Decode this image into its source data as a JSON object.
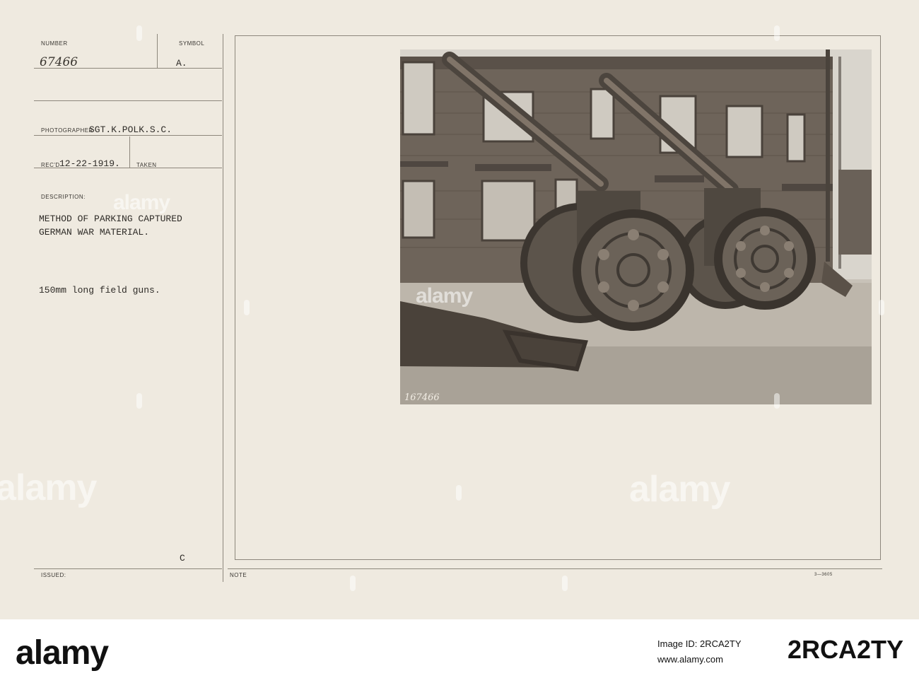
{
  "record": {
    "number_label": "NUMBER",
    "number": "67466",
    "symbol_label": "SYMBOL",
    "symbol": "A.",
    "photographer_label": "PHOTOGRAPHER",
    "photographer": "SGT.K.POLK.S.C.",
    "recd_label": "REC'D",
    "recd_date": "12-22-1919.",
    "taken_label": "TAKEN",
    "description_label": "DESCRIPTION:",
    "description_line1": "METHOD OF PARKING CAPTURED",
    "description_line2": "GERMAN WAR MATERIAL.",
    "subject": "150mm long field guns.",
    "issued_label": "ISSUED:",
    "issued_letter": "C",
    "note_label": "NOTE",
    "form_code": "3—3605"
  },
  "photo": {
    "negative_number": "167466"
  },
  "watermark": {
    "text": "alamy"
  },
  "footer": {
    "logo": "alamy",
    "image_id": "Image ID: 2RCA2TY",
    "url": "www.alamy.com",
    "code": "2RCA2TY"
  }
}
